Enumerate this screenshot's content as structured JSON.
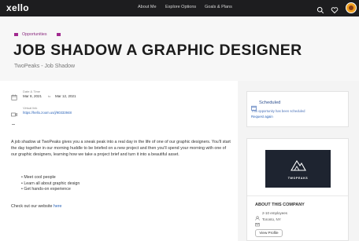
{
  "nav": {
    "logo": "xello",
    "links": [
      "About Me",
      "Explore Options",
      "Goals & Plans"
    ],
    "icons": [
      "search-icon",
      "heart-icon",
      "avatar"
    ]
  },
  "header": {
    "category": "Opportunities",
    "title": "JOB SHADOW A GRAPHIC DESIGNER",
    "subtitle": "TwoPeaks - Job Shadow"
  },
  "details": {
    "date_label": "Date & Time",
    "date_start": "Mar 8, 2021",
    "date_sep": "to",
    "date_end": "Mar 12, 2021",
    "link_label": "Virtual link",
    "link_url": "https://hello.zoom.us/j/90333948"
  },
  "description": "A job shadow at TwoPeaks gives you a sneak peak into a real day in the life of one of our graphic designers. You'll start the day together in our morning huddle to be briefed on a new project and then you'll spend your morning with one of our graphic designers, learning how we take a project brief and turn it into a beautiful asset.",
  "bullets": [
    "Meet cool people",
    "Learn all about graphic design",
    "Get hands-on experience"
  ],
  "checkout": {
    "prefix": "Check out our website ",
    "link": "here"
  },
  "status": {
    "title": "Scheduled",
    "note": "This opportunity has been scheduled",
    "link": "Request again"
  },
  "company": {
    "logo_text": "TWOPEAKS",
    "section_title": "ABOUT THIS COMPANY",
    "employees": "2-10 employees",
    "location": "Toronto, NY",
    "button": "View Profile"
  },
  "colors": {
    "nav_bg": "#1d1d1f",
    "accent": "#a12a8f",
    "link": "#2a63b8",
    "status": "#2e4f8e",
    "logo_bg": "#1e2430"
  }
}
